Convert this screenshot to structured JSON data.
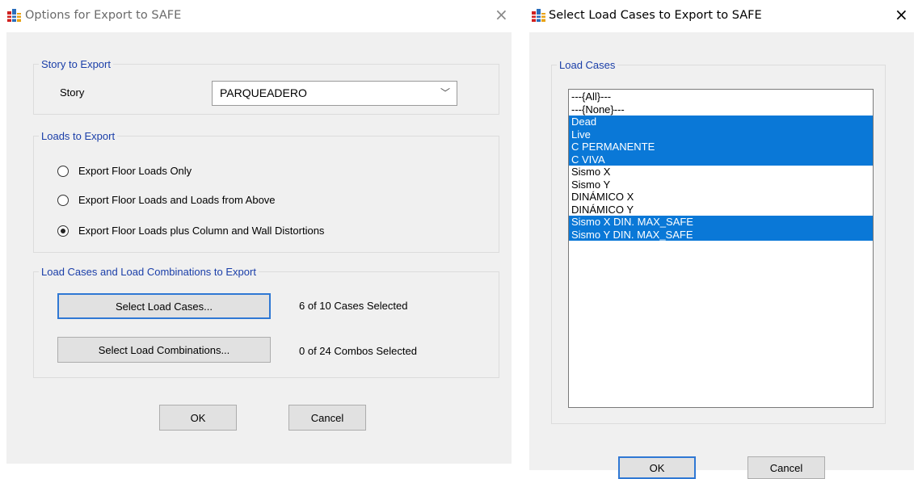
{
  "dialog1": {
    "title": "Options for Export to SAFE",
    "close": "×",
    "story_group": {
      "legend": "Story to Export",
      "story_label": "Story",
      "story_value": "PARQUEADERO",
      "arrow": "﹀"
    },
    "loads_group": {
      "legend": "Loads to Export",
      "options": [
        {
          "label": "Export Floor Loads Only",
          "selected": false
        },
        {
          "label": "Export Floor Loads and Loads from Above",
          "selected": false
        },
        {
          "label": "Export Floor Loads plus Column and Wall Distortions",
          "selected": true
        }
      ]
    },
    "cases_group": {
      "legend": "Load Cases and Load Combinations to Export",
      "select_cases_label": "Select Load Cases...",
      "cases_status": "6 of 10 Cases Selected",
      "select_combos_label": "Select Load Combinations...",
      "combos_status": "0 of 24 Combos Selected"
    },
    "ok": "OK",
    "cancel": "Cancel"
  },
  "dialog2": {
    "title": "Select Load Cases to Export to SAFE",
    "close": "×",
    "group_legend": "Load Cases",
    "items": [
      {
        "label": "---{All}---",
        "selected": false
      },
      {
        "label": "---{None}---",
        "selected": false
      },
      {
        "label": "Dead",
        "selected": true
      },
      {
        "label": "Live",
        "selected": true
      },
      {
        "label": "C PERMANENTE",
        "selected": true
      },
      {
        "label": "C VIVA",
        "selected": true
      },
      {
        "label": "Sismo X",
        "selected": false
      },
      {
        "label": "Sismo Y",
        "selected": false
      },
      {
        "label": "DINÁMICO X",
        "selected": false
      },
      {
        "label": "DINÁMICO Y",
        "selected": false
      },
      {
        "label": "Sismo X DIN. MAX_SAFE",
        "selected": true
      },
      {
        "label": "Sismo Y DIN. MAX_SAFE",
        "selected": true
      }
    ],
    "ok": "OK",
    "cancel": "Cancel"
  },
  "colors": {
    "selection": "#0a78d7",
    "legend": "#1a3ea8",
    "panel": "#f0f0f0",
    "focus_border": "#2f78d4"
  }
}
